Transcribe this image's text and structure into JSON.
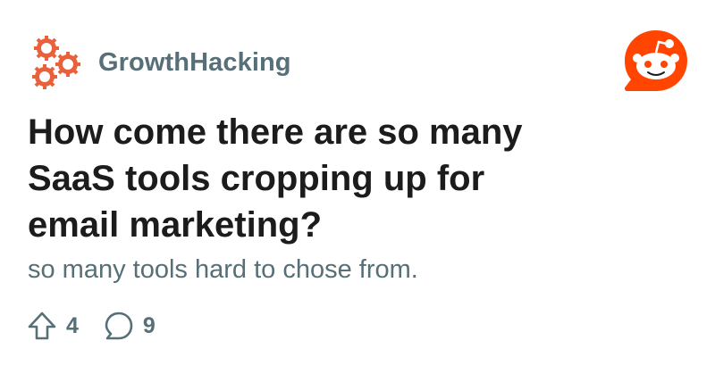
{
  "post": {
    "subreddit": "GrowthHacking",
    "title": "How come there are so many SaaS tools cropping up for email marketing?",
    "body": "so many tools hard to chose from.",
    "upvotes": "4",
    "comments": "9"
  },
  "icons": {
    "subreddit_avatar": "gears-icon",
    "brand_logo": "reddit-snoo-icon",
    "upvote": "upvote-arrow-icon",
    "comment": "comment-bubble-icon"
  },
  "colors": {
    "brand": "#ff4500",
    "muted_text": "#576f76",
    "title_text": "#1c1c1c",
    "gear": "#e8613b"
  }
}
